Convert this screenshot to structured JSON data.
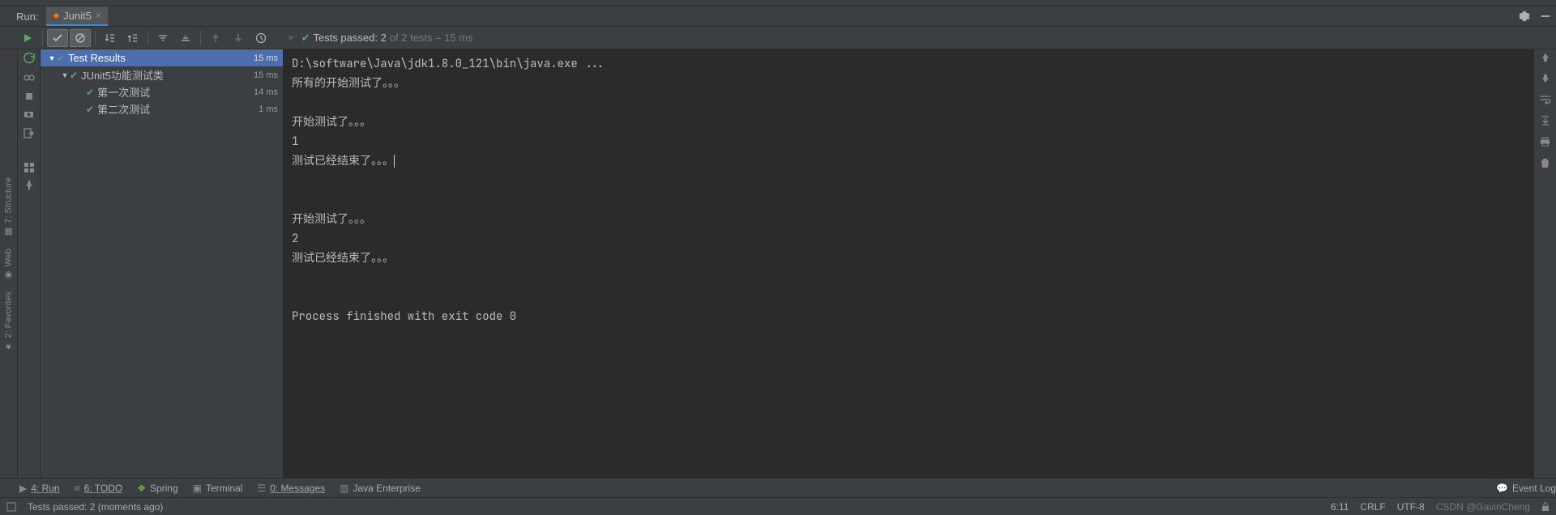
{
  "header": {
    "run_label": "Run:",
    "tab_label": "Junit5"
  },
  "toolbar_summary": {
    "bright": "Tests passed: 2",
    "dim": " of 2 tests – 15 ms"
  },
  "tree": {
    "root": {
      "label": "Test Results",
      "time": "15 ms"
    },
    "class": {
      "label": "JUnit5功能测试类",
      "time": "15 ms"
    },
    "tests": [
      {
        "label": "第一次测试",
        "time": "14 ms"
      },
      {
        "label": "第二次测试",
        "time": "1 ms"
      }
    ]
  },
  "console": {
    "lines": [
      "D:\\software\\Java\\jdk1.8.0_121\\bin\\java.exe ...",
      "所有的开始测试了。。。",
      "",
      "开始测试了。。。",
      "1",
      "测试已经结束了。。。",
      "",
      "",
      "开始测试了。。。",
      "2",
      "测试已经结束了。。。",
      "",
      "",
      "Process finished with exit code 0"
    ],
    "caret_line": 5
  },
  "left_labels": {
    "structure": "7: Structure",
    "web": "Web",
    "favorites": "2: Favorites"
  },
  "bottom_tabs": {
    "run": "4: Run",
    "todo": "6: TODO",
    "spring": "Spring",
    "terminal": "Terminal",
    "messages": "0: Messages",
    "java_ee": "Java Enterprise",
    "event_log": "Event Log"
  },
  "status": {
    "msg": "Tests passed: 2 (moments ago)",
    "pos": "6:11",
    "sep": "CRLF",
    "enc": "UTF-8",
    "watermark": "CSDN @GavinCheng"
  }
}
